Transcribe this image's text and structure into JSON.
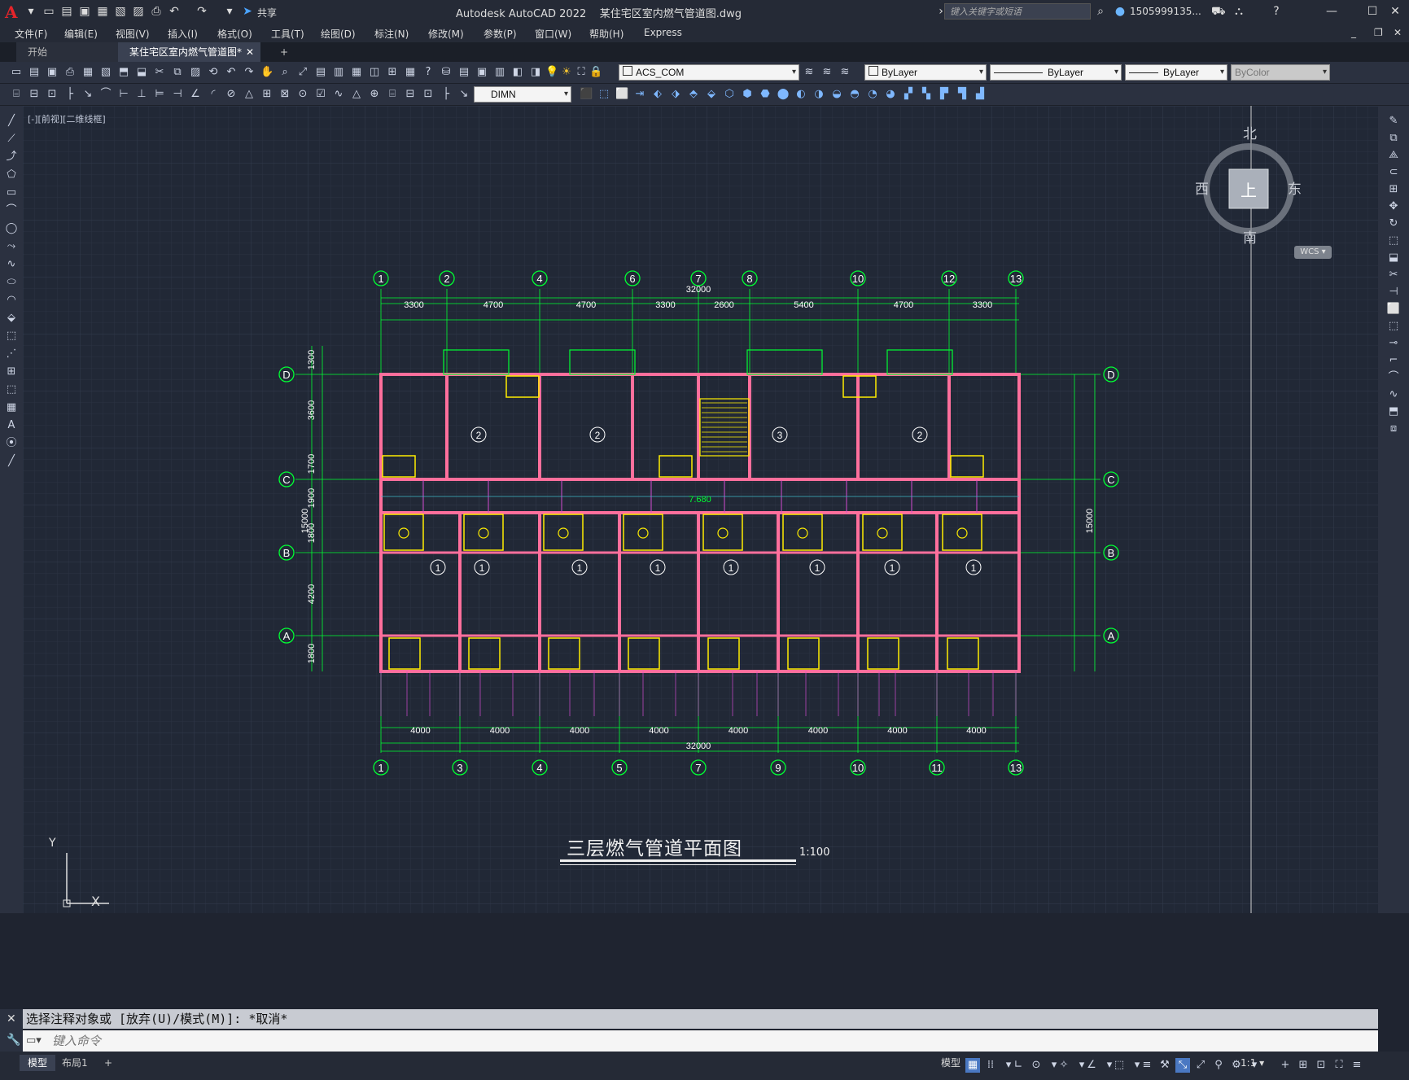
{
  "titlebar": {
    "app_title": "Autodesk AutoCAD 2022",
    "file_name": "某住宅区室内燃气管道图.dwg",
    "share_label": "共享",
    "search_placeholder": "键入关键字或短语",
    "user_name": "1505999135..."
  },
  "menu": [
    "文件(F)",
    "编辑(E)",
    "视图(V)",
    "插入(I)",
    "格式(O)",
    "工具(T)",
    "绘图(D)",
    "标注(N)",
    "修改(M)",
    "参数(P)",
    "窗口(W)",
    "帮助(H)",
    "Express"
  ],
  "tabs": {
    "start": "开始",
    "active": "某住宅区室内燃气管道图*"
  },
  "toolbar": {
    "ucs_combo": "ACS_COM",
    "color_combo": "ByLayer",
    "linetype_combo": "ByLayer",
    "lineweight_combo": "ByLayer",
    "plotstyle_combo": "ByColor",
    "dimstyle_combo": "DIMN"
  },
  "viewport_label": "[-][前视][二维线框]",
  "viewcube": {
    "north": "北",
    "south": "南",
    "east": "东",
    "west": "西",
    "top": "上",
    "wcs": "WCS"
  },
  "drawing": {
    "title": "三层燃气管道平面图",
    "scale": "1:100",
    "top_axes": [
      "1",
      "2",
      "4",
      "6",
      "7",
      "8",
      "10",
      "12",
      "13"
    ],
    "bottom_axes": [
      "1",
      "3",
      "4",
      "5",
      "7",
      "9",
      "10",
      "11",
      "13"
    ],
    "row_axes": [
      "D",
      "C",
      "B",
      "A"
    ],
    "total_width": "32000",
    "total_depth": "15000",
    "top_dims": [
      "3300",
      "4700",
      "4700",
      "3300",
      "2600",
      "5400",
      "4700",
      "3300"
    ],
    "bottom_dims": [
      "4000",
      "4000",
      "4000",
      "4000",
      "4000",
      "4000",
      "4000",
      "4000"
    ],
    "left_dims": [
      "1300",
      "3600",
      "1700",
      "1900",
      "1800",
      "4200",
      "1800"
    ],
    "elevation": "7.680",
    "room_circle_labels": [
      "2",
      "2",
      "3",
      "2",
      "1",
      "1",
      "1",
      "1",
      "1",
      "1",
      "1",
      "1"
    ]
  },
  "command": {
    "history": "选择注释对象或 [放弃(U)/模式(M)]: *取消*",
    "placeholder": "键入命令"
  },
  "status": {
    "model_tab": "模型",
    "layout_tab": "布局1",
    "model_label": "模型",
    "scale_label": "1:1"
  },
  "axes_label": {
    "x": "X",
    "y": "Y"
  }
}
